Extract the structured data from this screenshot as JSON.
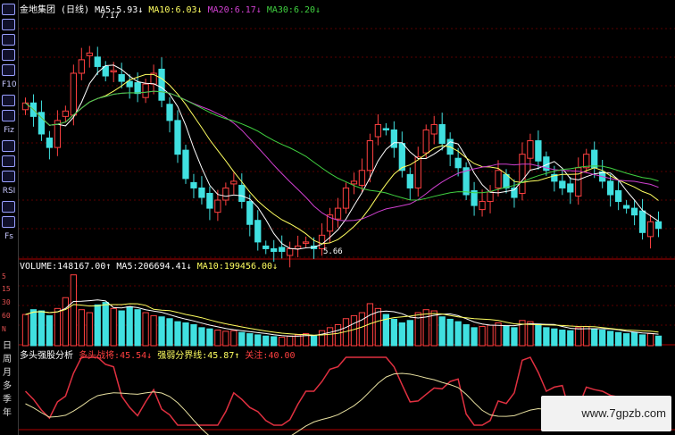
{
  "header": {
    "stock": "金地集团 (日线)",
    "ma5_label": "MA5:",
    "ma5_value": "5.93↓",
    "ma10_label": "MA10:",
    "ma10_value": "6.03↓",
    "ma20_label": "MA20:",
    "ma20_value": "6.17↓",
    "ma30_label": "MA30:",
    "ma30_value": "6.20↓"
  },
  "volume_header": {
    "label": "VOLUME:",
    "value": "148167.00↑",
    "ma5_label": "MA5:",
    "ma5_value": "206694.41↓",
    "ma10_label": "MA10:",
    "ma10_value": "199456.00↓"
  },
  "indicator_header": {
    "name": "多头强股分析",
    "strength_label": "多头战将:",
    "strength_value": "45.54↓",
    "divide_label": "强弱分界线:",
    "divide_value": "45.87↑",
    "attention_label": "关注:",
    "attention_value": "40.00"
  },
  "annotations": {
    "high": "7.17",
    "low": "5.66"
  },
  "y_axis": {
    "volume_ticks": [
      "5",
      "15",
      "30",
      "60",
      "N"
    ]
  },
  "periods": [
    "日",
    "周",
    "月",
    "多",
    "季",
    "年"
  ],
  "sidebar_icons": [
    "line-icon",
    "candle-icon",
    "bar-icon",
    "table-icon",
    "note-icon",
    "f10-icon",
    "search-icon",
    "tool-icon",
    "fiz-icon",
    "zoom-icon",
    "grid-icon",
    "chart-icon",
    "rsi-icon",
    "s-icon",
    "arrow-icon",
    "fs-icon"
  ],
  "sidebar_labels": {
    "f10": "F10",
    "fiz": "Fiz",
    "rsi": "RSI",
    "fs": "Fs"
  },
  "watermark": "www.7gpzb.com",
  "colors": {
    "up": "#ff4040",
    "down": "#40e0e0",
    "ma5": "#ffffff",
    "ma10": "#ffff60",
    "ma20": "#d040d0",
    "ma30": "#40d040",
    "background": "#000000",
    "grid": "#5a0000"
  },
  "chart_data": {
    "type": "candlestick",
    "days": 80,
    "price_range": [
      5.55,
      7.35
    ],
    "close": [
      6.68,
      6.58,
      6.45,
      6.35,
      6.55,
      6.62,
      6.9,
      7.0,
      7.05,
      6.95,
      6.88,
      6.92,
      6.84,
      6.8,
      6.75,
      6.82,
      6.9,
      6.7,
      6.55,
      6.3,
      6.12,
      6.05,
      5.98,
      5.9,
      5.96,
      6.05,
      6.1,
      5.95,
      5.78,
      5.65,
      5.6,
      5.58,
      5.58,
      5.6,
      5.62,
      5.65,
      5.6,
      5.7,
      5.85,
      5.9,
      6.05,
      6.1,
      6.18,
      6.4,
      6.52,
      6.48,
      6.35,
      6.18,
      6.05,
      6.28,
      6.48,
      6.52,
      6.38,
      6.3,
      6.2,
      6.0,
      5.92,
      5.95,
      6.02,
      6.18,
      6.05,
      5.98,
      6.3,
      6.4,
      6.25,
      6.18,
      6.1,
      6.05,
      6.02,
      6.2,
      6.3,
      6.2,
      6.1,
      6.0,
      5.95,
      5.9,
      5.85,
      5.72,
      5.8,
      5.75
    ],
    "volume": [
      52,
      60,
      58,
      50,
      62,
      80,
      118,
      60,
      55,
      68,
      72,
      62,
      58,
      65,
      60,
      55,
      50,
      48,
      45,
      40,
      38,
      35,
      30,
      28,
      26,
      24,
      25,
      22,
      20,
      18,
      16,
      15,
      14,
      16,
      18,
      20,
      17,
      25,
      30,
      35,
      45,
      50,
      55,
      70,
      62,
      52,
      44,
      38,
      42,
      55,
      60,
      58,
      48,
      44,
      40,
      35,
      30,
      32,
      34,
      38,
      33,
      30,
      42,
      40,
      36,
      30,
      28,
      26,
      25,
      30,
      32,
      28,
      26,
      24,
      22,
      20,
      22,
      18,
      20,
      16
    ]
  }
}
